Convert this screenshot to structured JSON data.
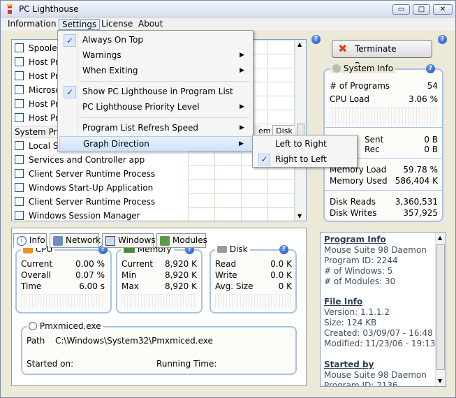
{
  "window": {
    "title": "PC Lighthouse",
    "min_glyph": "▭",
    "max_glyph": "□",
    "close_glyph": "✕"
  },
  "menubar": {
    "items": [
      "Information",
      "Settings",
      "License",
      "About"
    ]
  },
  "help_glyph": "?",
  "processes": {
    "rows": [
      {
        "label": "Spooler"
      },
      {
        "label": "Host Pro"
      },
      {
        "label": "Host Pro"
      },
      {
        "label": "Microso"
      },
      {
        "label": "Host Pro"
      },
      {
        "label": "Host Pro"
      }
    ],
    "group_label": "System Pro",
    "rows2": [
      {
        "label": "Local Se"
      },
      {
        "label": "Services and Controller app"
      },
      {
        "label": "Client Server Runtime Process"
      },
      {
        "label": "Windows Start-Up Application"
      },
      {
        "label": "Client Server Runtime Process"
      },
      {
        "label": "Windows Session Manager"
      }
    ],
    "col_item": "em",
    "col_disk": "Disk"
  },
  "terminate": {
    "label": "Terminate Program"
  },
  "system_info": {
    "title": "System Info",
    "programs_label": "# of Programs",
    "programs_value": "54",
    "cpu_label": "CPU Load",
    "cpu_value": "3.06 %",
    "sent_label": "Sent",
    "sent_value": "0 B",
    "rec_label": "Rec",
    "rec_value": "0 B",
    "mem_load_label": "Memory Load",
    "mem_load_value": "59.78 %",
    "mem_used_label": "Memory Used",
    "mem_used_value": "586,404 K",
    "disk_reads_label": "Disk Reads",
    "disk_reads_value": "3,360,531",
    "disk_writes_label": "Disk Writes",
    "disk_writes_value": "357,925"
  },
  "tabs": [
    "Info",
    "Network",
    "Windows",
    "Modules"
  ],
  "cpu": {
    "title": "CPU",
    "current_label": "Current",
    "current_value": "0.00 %",
    "overall_label": "Overall",
    "overall_value": "0.07 %",
    "time_label": "Time",
    "time_value": "6.00 s"
  },
  "memory": {
    "title": "Memory",
    "current_label": "Current",
    "current_value": "8,920 K",
    "min_label": "Min",
    "min_value": "8,920 K",
    "max_label": "Max",
    "max_value": "8,920 K"
  },
  "disk": {
    "title": "Disk",
    "read_label": "Read",
    "read_value": "0.0 K",
    "write_label": "Write",
    "write_value": "0.0 K",
    "avg_label": "Avg. Size",
    "avg_value": "0 K"
  },
  "process_detail": {
    "name": "Pmxmiced.exe",
    "path_label": "Path",
    "path_value": "C:\\Windows\\System32\\Pmxmiced.exe",
    "started_label": "Started on:",
    "running_label": "Running Time:"
  },
  "info_panel": {
    "program_info_h": "Program Info",
    "program_name": "Mouse Suite 98 Daemon",
    "program_id": "Program ID: 2244",
    "windows": "# of Windows: 5",
    "modules": "# of Modules: 30",
    "file_info_h": "File Info",
    "version": "Version: 1.1.1.2",
    "size": "Size: 124 KB",
    "created": "Created: 03/09/07 - 16:48",
    "modified": "Modified: 11/23/06 - 19:13",
    "started_by_h": "Started by",
    "started_by_name": "Mouse Suite 98 Daemon",
    "started_by_id": "Program ID: 2136"
  },
  "settings_menu": {
    "always_on_top": "Always On Top",
    "warnings": "Warnings",
    "when_exiting": "When Exiting",
    "show_in_list": "Show PC Lighthouse in Program List",
    "priority": "PC Lighthouse Priority Level",
    "refresh": "Program List Refresh Speed",
    "graph_direction": "Graph Direction",
    "check": "✓",
    "arrow": "▶"
  },
  "graph_submenu": {
    "left_to_right": "Left to Right",
    "right_to_left": "Right to Left"
  },
  "scroll": {
    "up": "▲",
    "down": "▼"
  }
}
